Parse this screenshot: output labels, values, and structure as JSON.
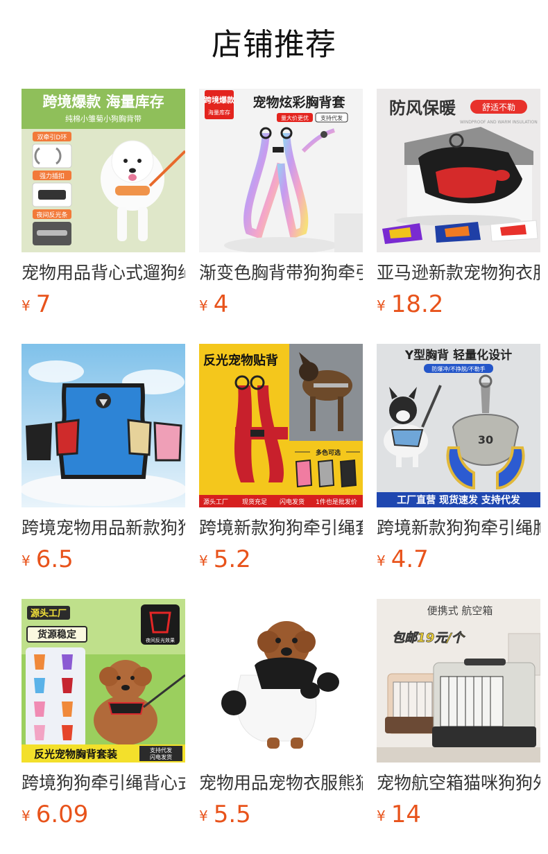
{
  "page": {
    "title": "店铺推荐"
  },
  "products": [
    {
      "name": "宠物用品背心式遛狗绳",
      "currency": "¥",
      "price": "7",
      "image": {
        "headline": "跨境爆款 海量库存",
        "subline": "纯棉小雏菊小狗胸背带",
        "tags": [
          "双牵引D环",
          "强力插扣",
          "夜间反光条"
        ]
      }
    },
    {
      "name": "渐变色胸背带狗狗牵引绳",
      "currency": "¥",
      "price": "4",
      "image": {
        "badge": "跨境爆款",
        "badge_sub": "海量库存",
        "headline": "宠物炫彩胸背套",
        "tag1": "量大价更优",
        "tag2": "支持代发"
      }
    },
    {
      "name": "亚马逊新款宠物狗衣服",
      "currency": "¥",
      "price": "18.2",
      "image": {
        "headline": "防风保暖",
        "badge": "舒适不勒",
        "subline": "WINDPROOF AND WARM INSULATION"
      }
    },
    {
      "name": "跨境宠物用品新款狗狗胸背",
      "currency": "¥",
      "price": "6.5",
      "image": {}
    },
    {
      "name": "跨境新款狗狗牵引绳套装",
      "currency": "¥",
      "price": "5.2",
      "image": {
        "headline": "反光宠物贴背",
        "colors_label": "多色可选",
        "footer": [
          "源头工厂",
          "现货充足",
          "闪电发货",
          "1件也是批发价"
        ]
      }
    },
    {
      "name": "跨境新款狗狗牵引绳胸背",
      "currency": "¥",
      "price": "4.7",
      "image": {
        "headline": "Y型胸背 轻量化设计",
        "tag": "防爆冲/不挣脱/不勒手",
        "number": "30",
        "footer": "工厂直营 现货速发 支持代发"
      }
    },
    {
      "name": "跨境狗狗牵引绳背心式胸背",
      "currency": "¥",
      "price": "6.09",
      "image": {
        "label1": "源头工厂",
        "label2": "货源稳定",
        "inset": "夜间反光效果",
        "footer": "反光宠物胸背套装",
        "footer_side1": "支持代发",
        "footer_side2": "闪电发货"
      }
    },
    {
      "name": "宠物用品宠物衣服熊猫装",
      "currency": "¥",
      "price": "5.5",
      "image": {}
    },
    {
      "name": "宠物航空箱猫咪狗狗外出",
      "currency": "¥",
      "price": "14",
      "image": {
        "headline": "便携式 航空箱",
        "promo": "包邮19元/个"
      }
    }
  ],
  "colors": {
    "price": "#e8531b",
    "title": "#111111",
    "name": "#333333"
  }
}
